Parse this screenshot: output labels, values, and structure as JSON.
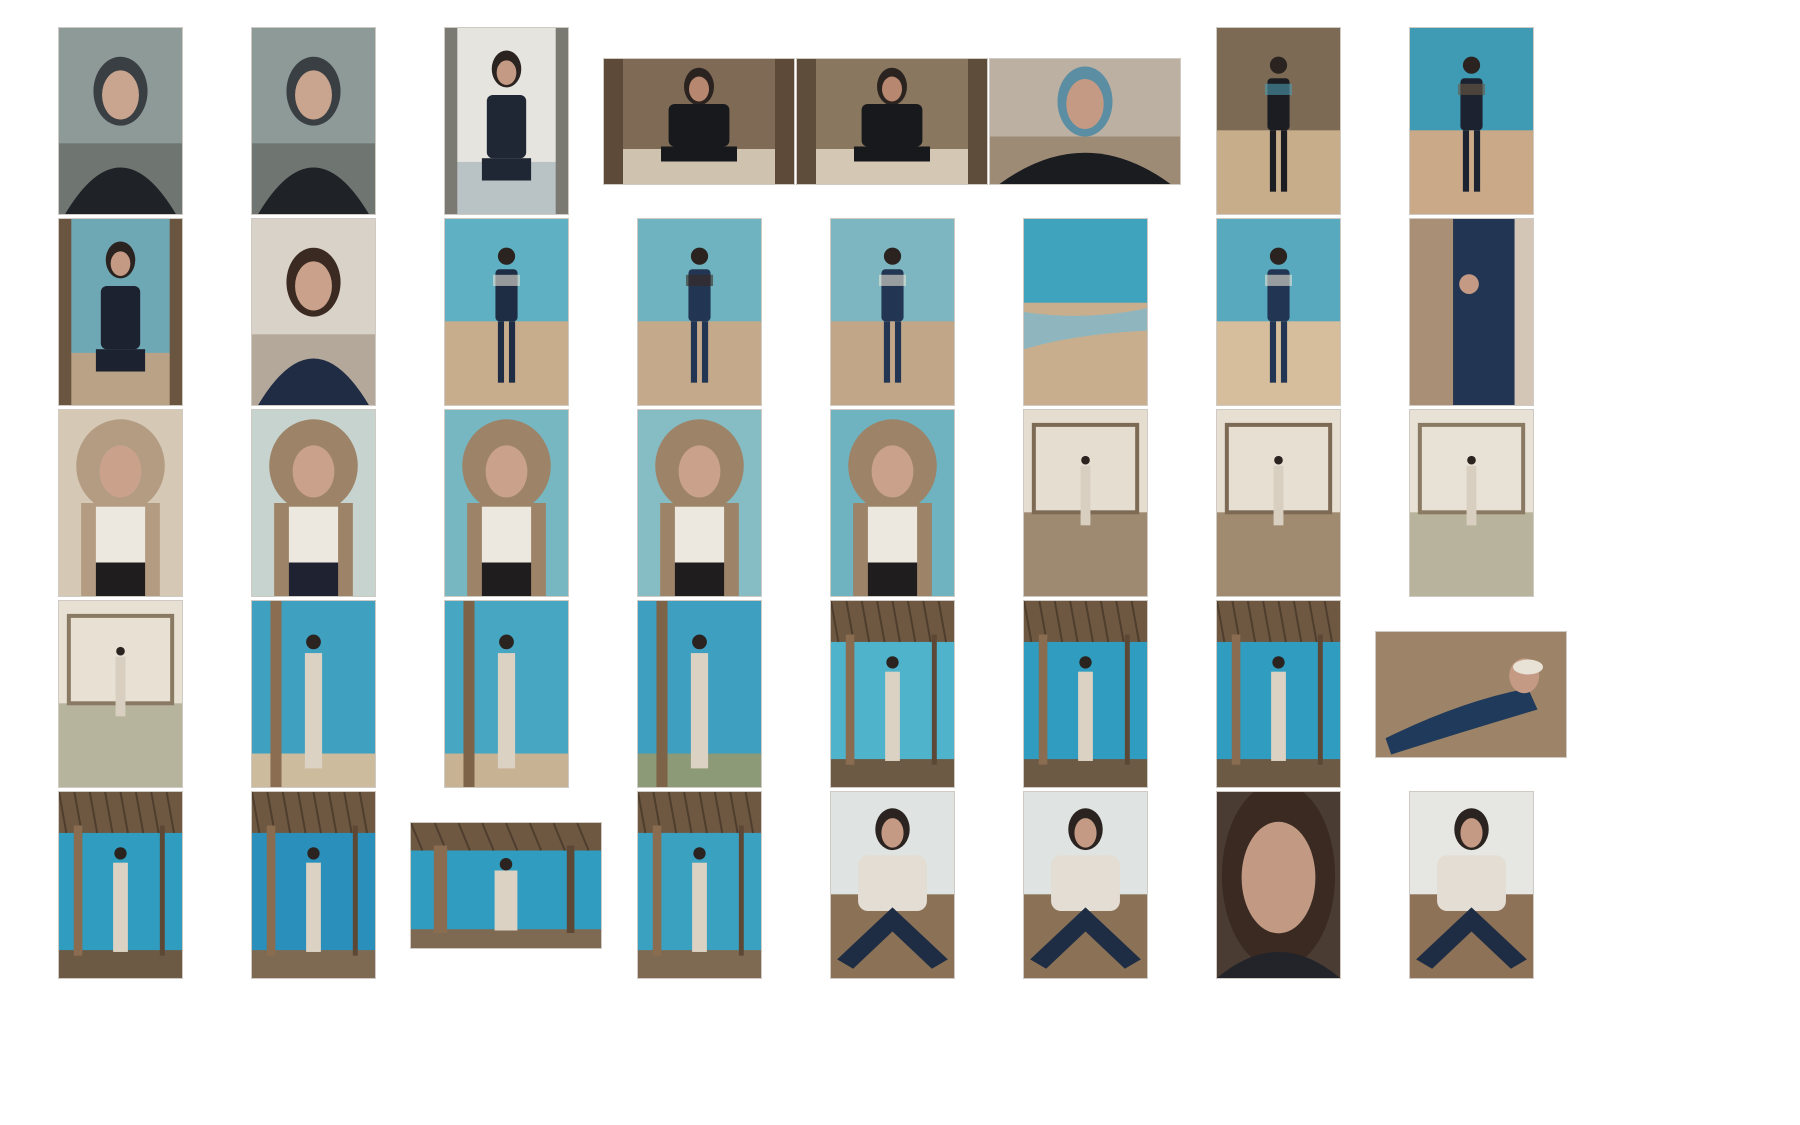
{
  "gallery": {
    "rows": 5,
    "columns": 8,
    "items": [
      {
        "orientation": "portrait",
        "scene": "headshot",
        "palette": {
          "bg": "#8e9a97",
          "ground": "#6f7672",
          "figure": "#1f2226",
          "skin": "#c9a58f",
          "accent": "#3a3f44"
        }
      },
      {
        "orientation": "portrait",
        "scene": "headshot",
        "palette": {
          "bg": "#8e9a97",
          "ground": "#6f7672",
          "figure": "#1f2226",
          "skin": "#c9a58f",
          "accent": "#3a3f44"
        }
      },
      {
        "orientation": "portrait",
        "scene": "sitting",
        "palette": {
          "bg": "#e6e4df",
          "ground": "#b9c3c5",
          "figure": "#1e2733",
          "skin": "#c49a84",
          "accent": "#7b7a72"
        }
      },
      {
        "orientation": "landscape",
        "scene": "sitting",
        "palette": {
          "bg": "#7e6a55",
          "ground": "#cfc2ae",
          "figure": "#17191c",
          "skin": "#b8876f",
          "accent": "#5d4a38"
        }
      },
      {
        "orientation": "landscape",
        "scene": "sitting",
        "palette": {
          "bg": "#8a775f",
          "ground": "#d4c8b4",
          "figure": "#17191c",
          "skin": "#b8876f",
          "accent": "#5f4d3c"
        }
      },
      {
        "orientation": "landscape",
        "scene": "headshot",
        "palette": {
          "bg": "#bcb0a2",
          "ground": "#9d8b75",
          "figure": "#1a1c20",
          "skin": "#c49a84",
          "accent": "#5b8ea2"
        }
      },
      {
        "orientation": "portrait",
        "scene": "standing",
        "palette": {
          "bg": "#7c6a55",
          "ground": "#c7ad8a",
          "figure": "#1b1d22",
          "skin": "#c49a84",
          "accent": "#4f9bb0"
        }
      },
      {
        "orientation": "portrait",
        "scene": "standing",
        "palette": {
          "bg": "#3f9ab4",
          "ground": "#c9a987",
          "figure": "#1c2230",
          "skin": "#c49a84",
          "accent": "#6b5a45"
        }
      },
      {
        "orientation": "portrait",
        "scene": "sitting",
        "palette": {
          "bg": "#6fa8b5",
          "ground": "#b9a285",
          "figure": "#1c2230",
          "skin": "#c49a84",
          "accent": "#6a5540"
        }
      },
      {
        "orientation": "portrait",
        "scene": "headshot",
        "palette": {
          "bg": "#d9d2c8",
          "ground": "#b3a89a",
          "figure": "#1f2c44",
          "skin": "#caa28c",
          "accent": "#3a2a22"
        }
      },
      {
        "orientation": "portrait",
        "scene": "standing",
        "palette": {
          "bg": "#5fb0c2",
          "ground": "#c8ad8c",
          "figure": "#1f2d44",
          "skin": "#c49a84",
          "accent": "#e8e2d6"
        }
      },
      {
        "orientation": "portrait",
        "scene": "standing",
        "palette": {
          "bg": "#6fb3c0",
          "ground": "#c4a98a",
          "figure": "#223552",
          "skin": "#c49a84",
          "accent": "#3a2a22"
        }
      },
      {
        "orientation": "portrait",
        "scene": "standing",
        "palette": {
          "bg": "#7db6c0",
          "ground": "#c1a688",
          "figure": "#223552",
          "skin": "#c49a84",
          "accent": "#e8e2d6"
        }
      },
      {
        "orientation": "portrait",
        "scene": "seascape",
        "palette": {
          "bg": "#3fa3bd",
          "ground": "#c9ae8d",
          "figure": "#6fa4b4",
          "skin": "#c49a84",
          "accent": "#8fb6bf"
        }
      },
      {
        "orientation": "portrait",
        "scene": "standing",
        "palette": {
          "bg": "#58a9bd",
          "ground": "#d6bd9c",
          "figure": "#223552",
          "skin": "#c49a84",
          "accent": "#e8e2d6"
        }
      },
      {
        "orientation": "portrait",
        "scene": "detail",
        "palette": {
          "bg": "#d3c6b6",
          "ground": "#c7b19a",
          "figure": "#223552",
          "skin": "#c49a84",
          "accent": "#a88f75"
        }
      },
      {
        "orientation": "portrait",
        "scene": "hood",
        "palette": {
          "bg": "#d5c9b6",
          "ground": "#ece8e0",
          "figure": "#b49c82",
          "skin": "#caa28c",
          "accent": "#1f1d1d"
        }
      },
      {
        "orientation": "portrait",
        "scene": "hood",
        "palette": {
          "bg": "#c7d3cf",
          "ground": "#ece8e0",
          "figure": "#9d8468",
          "skin": "#caa28c",
          "accent": "#1f2230"
        }
      },
      {
        "orientation": "portrait",
        "scene": "hood",
        "palette": {
          "bg": "#76b7c1",
          "ground": "#ece8e0",
          "figure": "#9d8468",
          "skin": "#caa28c",
          "accent": "#1f1d1d"
        }
      },
      {
        "orientation": "portrait",
        "scene": "hood",
        "palette": {
          "bg": "#86bdc4",
          "ground": "#ece8e0",
          "figure": "#9d8468",
          "skin": "#caa28c",
          "accent": "#1f1d1d"
        }
      },
      {
        "orientation": "portrait",
        "scene": "hood",
        "palette": {
          "bg": "#6fb3c0",
          "ground": "#ece8e0",
          "figure": "#9d8468",
          "skin": "#caa28c",
          "accent": "#1f1d1d"
        }
      },
      {
        "orientation": "portrait",
        "scene": "interior",
        "palette": {
          "bg": "#e5ddd0",
          "ground": "#9e8a70",
          "figure": "#d8cfc0",
          "skin": "#c49a84",
          "accent": "#7d6a55"
        }
      },
      {
        "orientation": "portrait",
        "scene": "interior",
        "palette": {
          "bg": "#e7dfd2",
          "ground": "#a08b71",
          "figure": "#d8cfc0",
          "skin": "#c49a84",
          "accent": "#7d6a55"
        }
      },
      {
        "orientation": "portrait",
        "scene": "interior",
        "palette": {
          "bg": "#e8e2d6",
          "ground": "#b8b39c",
          "figure": "#d8cfc0",
          "skin": "#c49a84",
          "accent": "#8a7a63"
        }
      },
      {
        "orientation": "portrait",
        "scene": "interior",
        "palette": {
          "bg": "#e7e0d3",
          "ground": "#b7b49d",
          "figure": "#d8cfc0",
          "skin": "#c49a84",
          "accent": "#8a7a63"
        }
      },
      {
        "orientation": "portrait",
        "scene": "pole",
        "palette": {
          "bg": "#3fa0bf",
          "ground": "#cdbb9e",
          "figure": "#dcd2c3",
          "skin": "#c49a84",
          "accent": "#8b6e52"
        }
      },
      {
        "orientation": "portrait",
        "scene": "pole",
        "palette": {
          "bg": "#47a6c2",
          "ground": "#c7b394",
          "figure": "#dcd2c3",
          "skin": "#c49a84",
          "accent": "#7d6449"
        }
      },
      {
        "orientation": "portrait",
        "scene": "pole",
        "palette": {
          "bg": "#3f9fc0",
          "ground": "#8d9a77",
          "figure": "#dcd2c3",
          "skin": "#c49a84",
          "accent": "#7d6449"
        }
      },
      {
        "orientation": "portrait",
        "scene": "canopy",
        "palette": {
          "bg": "#4fb3cb",
          "ground": "#6c5a45",
          "figure": "#dcd2c3",
          "skin": "#c49a84",
          "accent": "#6e5842"
        }
      },
      {
        "orientation": "portrait",
        "scene": "canopy",
        "palette": {
          "bg": "#2f9cc0",
          "ground": "#6c5a45",
          "figure": "#dcd2c3",
          "skin": "#c49a84",
          "accent": "#6e5842"
        }
      },
      {
        "orientation": "portrait",
        "scene": "canopy",
        "palette": {
          "bg": "#2f9cc0",
          "ground": "#6c5a45",
          "figure": "#dcd2c3",
          "skin": "#c49a84",
          "accent": "#6e5842"
        }
      },
      {
        "orientation": "landscape",
        "scene": "lying",
        "palette": {
          "bg": "#b49a7e",
          "ground": "#9d8468",
          "figure": "#1f3a5a",
          "skin": "#c49a84",
          "accent": "#e8e2d6"
        }
      },
      {
        "orientation": "portrait",
        "scene": "canopy",
        "palette": {
          "bg": "#2f9cc0",
          "ground": "#6c5a45",
          "figure": "#dcd2c3",
          "skin": "#c49a84",
          "accent": "#6e5842"
        }
      },
      {
        "orientation": "portrait",
        "scene": "canopy",
        "palette": {
          "bg": "#2a8fbb",
          "ground": "#7e6a52",
          "figure": "#dcd2c3",
          "skin": "#c49a84",
          "accent": "#6e5842"
        }
      },
      {
        "orientation": "landscape",
        "scene": "canopy",
        "palette": {
          "bg": "#2f9cc0",
          "ground": "#7e6a52",
          "figure": "#dcd2c3",
          "skin": "#c49a84",
          "accent": "#6e5842"
        }
      },
      {
        "orientation": "portrait",
        "scene": "canopy",
        "palette": {
          "bg": "#3aa1c1",
          "ground": "#7e6a52",
          "figure": "#dcd2c3",
          "skin": "#c49a84",
          "accent": "#6e5842"
        }
      },
      {
        "orientation": "portrait",
        "scene": "floor-sit",
        "palette": {
          "bg": "#dfe4e2",
          "ground": "#8b7257",
          "figure": "#e3ddd3",
          "skin": "#c49a84",
          "accent": "#1f2d44"
        }
      },
      {
        "orientation": "portrait",
        "scene": "floor-sit",
        "palette": {
          "bg": "#dfe4e2",
          "ground": "#8b7257",
          "figure": "#e3ddd3",
          "skin": "#c49a84",
          "accent": "#1f2d44"
        }
      },
      {
        "orientation": "portrait",
        "scene": "closeup",
        "palette": {
          "bg": "#4b3c33",
          "ground": "#2f2620",
          "figure": "#22242a",
          "skin": "#c29a84",
          "accent": "#3a2a22"
        }
      },
      {
        "orientation": "portrait",
        "scene": "floor-sit",
        "palette": {
          "bg": "#e6e7e2",
          "ground": "#8e7258",
          "figure": "#e3ddd3",
          "skin": "#c49a84",
          "accent": "#1f2d44"
        }
      }
    ]
  }
}
